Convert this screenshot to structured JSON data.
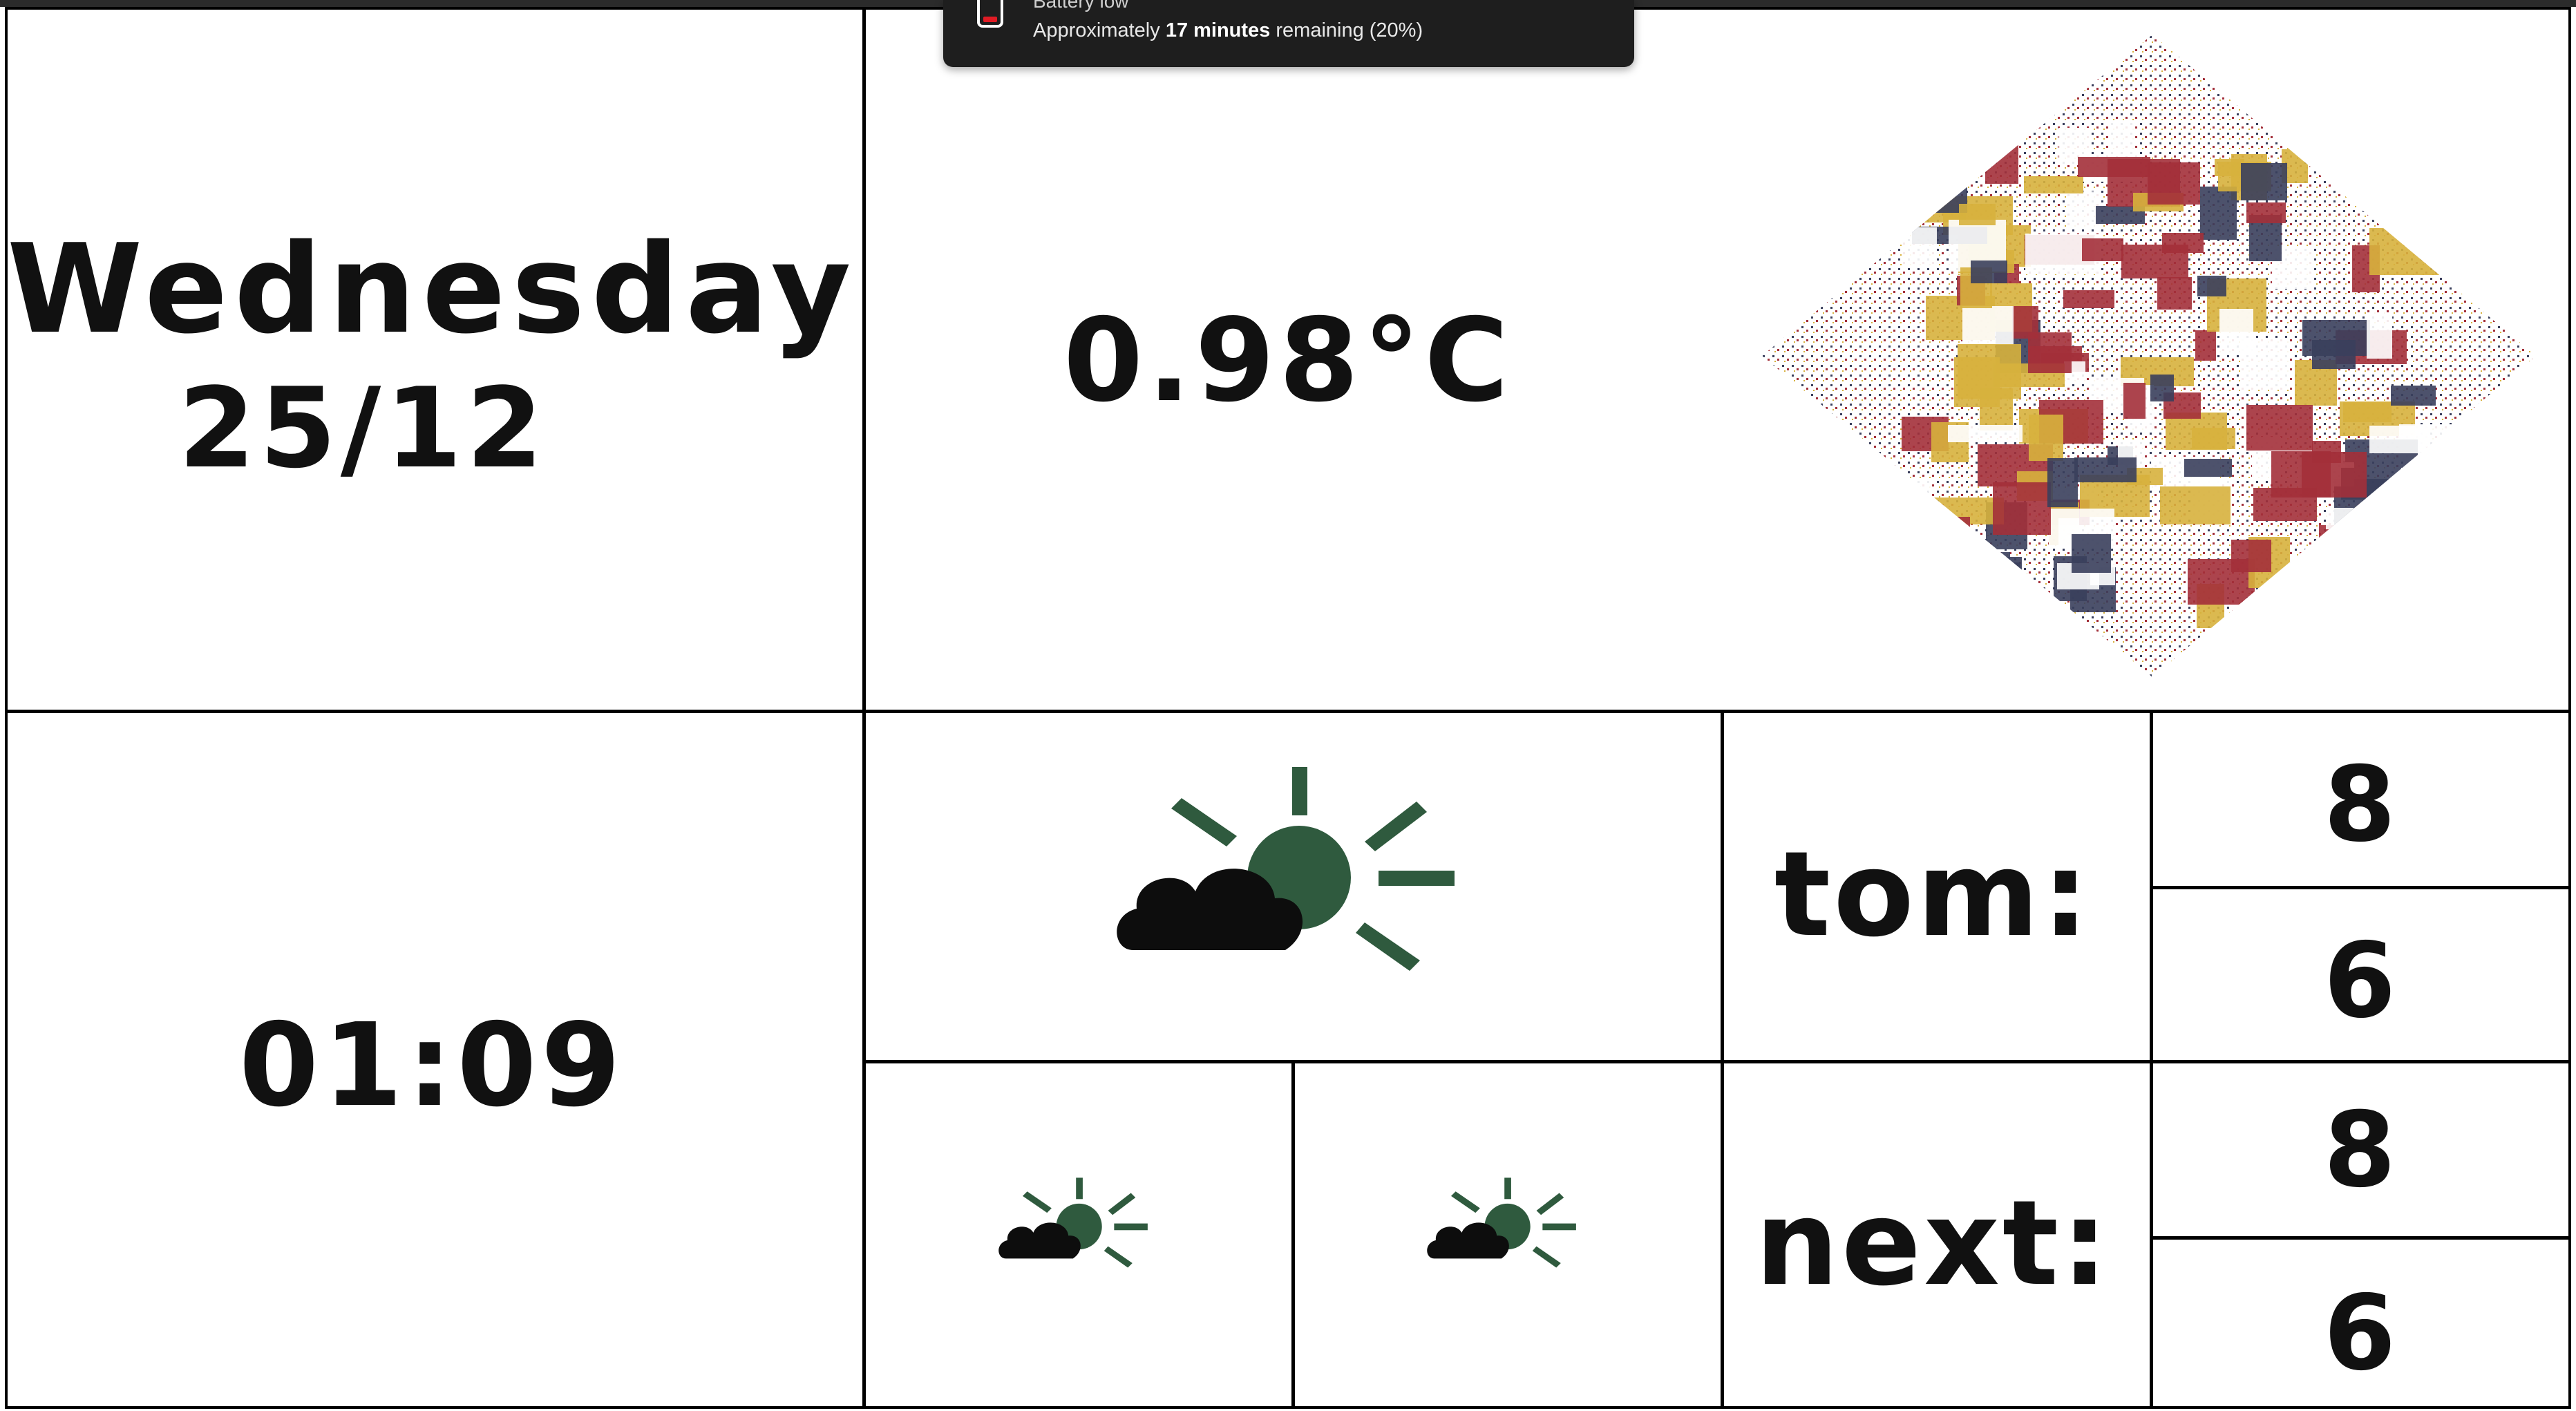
{
  "notification": {
    "title": "Battery low",
    "body_prefix": "Approximately ",
    "body_bold": "17 minutes",
    "body_suffix": " remaining (20%)",
    "battery_percent": 20,
    "icon": "battery-low-icon"
  },
  "dashboard": {
    "day": "Wednesday",
    "date": "25/12",
    "temperature": "0.98°C",
    "time": "01:09",
    "current_weather_icon": "partly-cloudy-icon",
    "forecast": {
      "tomorrow": {
        "label": "tom:",
        "high": "8",
        "low": "6",
        "icon": "partly-cloudy-icon"
      },
      "next": {
        "label": "next:",
        "high": "8",
        "low": "6",
        "icon": "partly-cloudy-icon"
      }
    },
    "art_icon": "mosaic-diamond-art"
  },
  "colors": {
    "sun": "#2f5a3e",
    "cloud": "#0d0d0d",
    "art_red": "#a3303a",
    "art_yellow": "#d7b13d",
    "art_blue": "#3a3f5c",
    "battery_red": "#e01b24"
  }
}
